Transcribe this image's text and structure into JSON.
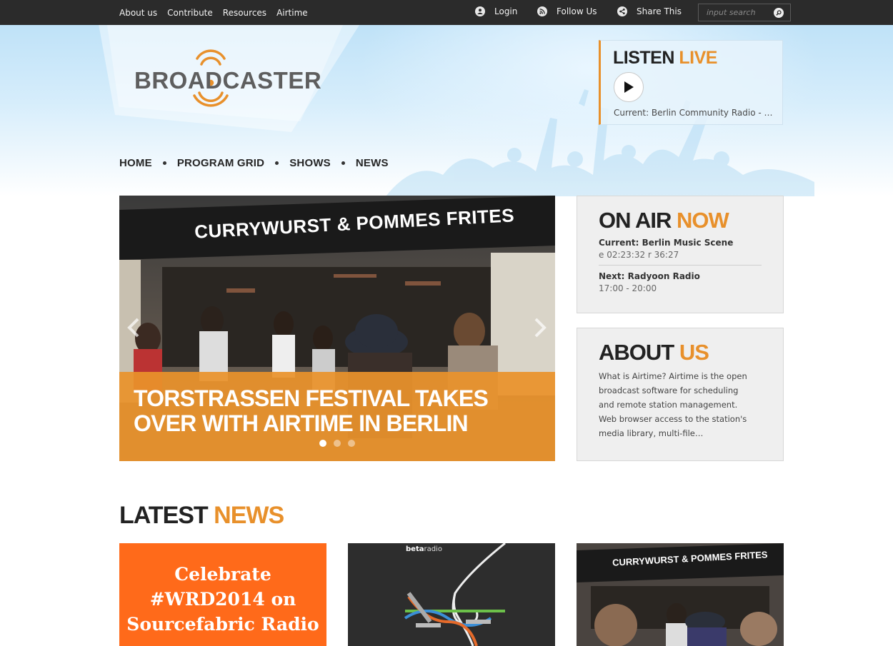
{
  "topbar": {
    "links": [
      "About us",
      "Contribute",
      "Resources",
      "Airtime"
    ],
    "login": "Login",
    "follow": "Follow Us",
    "share": "Share This",
    "search_placeholder": "input search"
  },
  "header": {
    "logo_text": "BROADCASTER",
    "listen_title": "LISTEN",
    "listen_accent": "LIVE",
    "current": "Current: Berlin Community Radio - About",
    "nav": [
      "HOME",
      "PROGRAM GRID",
      "SHOWS",
      "NEWS"
    ]
  },
  "slider": {
    "caption": "TORSTRASSEN FESTIVAL TAKES OVER WITH AIRTIME IN BERLIN",
    "sign_text": "CURRYWURST & POMMES FRITES",
    "slides": 3,
    "active_slide": 1
  },
  "onair": {
    "title": "ON AIR",
    "accent": "NOW",
    "current": "Current: Berlin Music Scene",
    "current_time": "e 02:23:32 r 36:27",
    "next": "Next: Radyoon Radio",
    "next_time": "17:00 - 20:00"
  },
  "about": {
    "title": "ABOUT",
    "accent": "US",
    "text": "What is Airtime? Airtime is the open broadcast software for scheduling and remote station management. Web browser access to the station's media library, multi-file…"
  },
  "latest": {
    "title": "LATEST",
    "accent": "NEWS",
    "cards": [
      {
        "lines": [
          "Celebrate",
          "#WRD2014 on",
          "Sourcefabric Radio"
        ]
      },
      {
        "brand_bold": "beta",
        "brand_rest": "radio"
      },
      {
        "sign_text": "CURRYWURST & POMMES FRITES"
      }
    ]
  },
  "colors": {
    "accent": "#e8902b",
    "topbar": "#2b2b2b"
  }
}
